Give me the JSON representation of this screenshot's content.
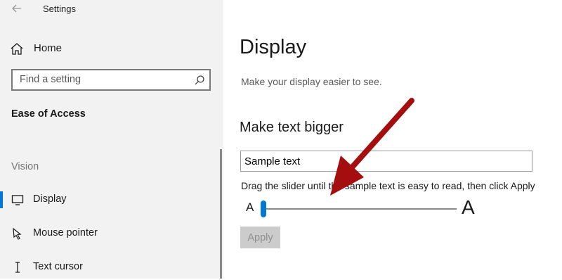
{
  "window": {
    "title": "Settings"
  },
  "sidebar": {
    "home_label": "Home",
    "search_placeholder": "Find a setting",
    "section_title": "Ease of Access",
    "group_label": "Vision",
    "items": [
      {
        "label": "Display",
        "icon": "monitor-icon",
        "active": true
      },
      {
        "label": "Mouse pointer",
        "icon": "mouse-pointer-icon",
        "active": false
      },
      {
        "label": "Text cursor",
        "icon": "text-cursor-icon",
        "active": false
      }
    ]
  },
  "main": {
    "title": "Display",
    "subtitle": "Make your display easier to see.",
    "section_heading": "Make text bigger",
    "sample_text": "Sample text",
    "instructions": "Drag the slider until the sample text is easy to read, then click Apply",
    "slider": {
      "min_label": "A",
      "max_label": "A",
      "value_percent": 0
    },
    "apply_label": "Apply"
  },
  "colors": {
    "accent": "#0078d7",
    "annotation_arrow": "#a50e0e",
    "sidebar_bg": "#f2f2f2",
    "disabled_button": "#cccccc"
  }
}
